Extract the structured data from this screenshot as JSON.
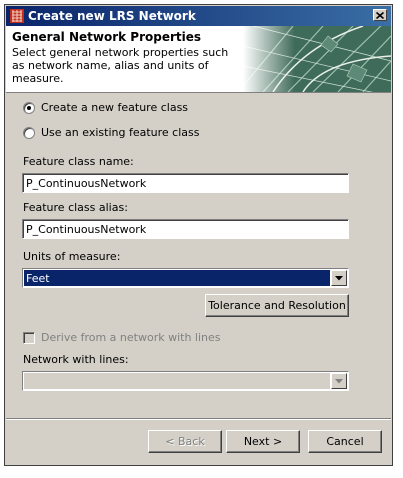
{
  "window": {
    "title": "Create new LRS Network"
  },
  "header": {
    "title": "General Network Properties",
    "description": "Select general network properties such as network name, alias and units of measure."
  },
  "options": {
    "create_new": "Create a new feature class",
    "use_existing": "Use an existing feature class",
    "selected": "create_new"
  },
  "fields": {
    "name_label": "Feature class name:",
    "name_value": "P_ContinuousNetwork",
    "alias_label": "Feature class alias:",
    "alias_value": "P_ContinuousNetwork",
    "units_label": "Units of measure:",
    "units_value": "Feet"
  },
  "buttons": {
    "tolerance": "Tolerance and Resolution",
    "back": "< Back",
    "next": "Next >",
    "cancel": "Cancel"
  },
  "derive": {
    "checkbox_label": "Derive from a network with lines",
    "network_label": "Network with lines:",
    "network_value": ""
  },
  "colors": {
    "titlebar": "#0a246a",
    "dialog_bg": "#d4d0c8",
    "selection": "#0a246a"
  }
}
